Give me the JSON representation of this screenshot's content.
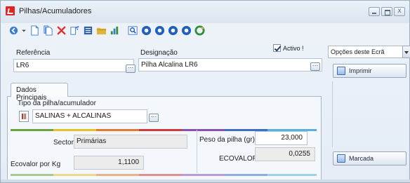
{
  "window": {
    "title": "Pilhas/Acumuladores"
  },
  "toolbar": {
    "items": [
      {
        "name": "back-icon",
        "color": "#3a7bd5"
      },
      {
        "name": "dropdown-icon",
        "color": "#3a7bd5"
      },
      {
        "name": "new-document-icon",
        "color": "#3a7bd5"
      },
      {
        "name": "copy-document-icon",
        "color": "#3a7bd5"
      },
      {
        "name": "delete-icon",
        "color": "#e0302a"
      },
      {
        "name": "edit-icon",
        "color": "#3a7bd5"
      },
      {
        "name": "list-icon",
        "color": "#3a7bd5"
      },
      {
        "name": "folder-icon",
        "color": "#e1b53a"
      },
      {
        "name": "chart-icon",
        "color": "#3a8f3a"
      },
      {
        "name": "search-icon",
        "color": "#3a7bd5"
      },
      {
        "name": "first-record-icon",
        "color": "#1f5fbf"
      },
      {
        "name": "previous-record-icon",
        "color": "#1f5fbf"
      },
      {
        "name": "next-record-icon",
        "color": "#1f5fbf"
      },
      {
        "name": "last-record-icon",
        "color": "#1f5fbf"
      },
      {
        "name": "refresh-icon",
        "color": "#2f8f3f"
      }
    ]
  },
  "form": {
    "referencia_label": "Referência",
    "referencia_value": "LR6",
    "designacao_label": "Designação",
    "designacao_value": "Pilha Alcalina LR6",
    "activo_label": "Activo !",
    "activo_checked": true
  },
  "tabs": [
    {
      "label": "Dados Principais",
      "active": true
    }
  ],
  "dados": {
    "tipo_label": "Tipo da pilha/acumulador",
    "tipo_value": "SALINAS + ALCALINAS",
    "sector_label": "Sector",
    "sector_value": "Primárias",
    "ecovalor_kg_label": "Ecovalor por Kg",
    "ecovalor_kg_value": "1,1100",
    "peso_label": "Peso da pilha (gr)",
    "peso_value": "23,000",
    "ecovalor_label": "ECOVALOR",
    "ecovalor_value": "0,0255"
  },
  "sidebar": {
    "options_combo": "Opções deste Ecrã",
    "imprimir_label": "Imprimir",
    "marcada_label": "Marcada"
  },
  "colors": {
    "accent": "#e52121",
    "panel_bg": "#f4f7fb",
    "border": "#a9b8c9"
  }
}
